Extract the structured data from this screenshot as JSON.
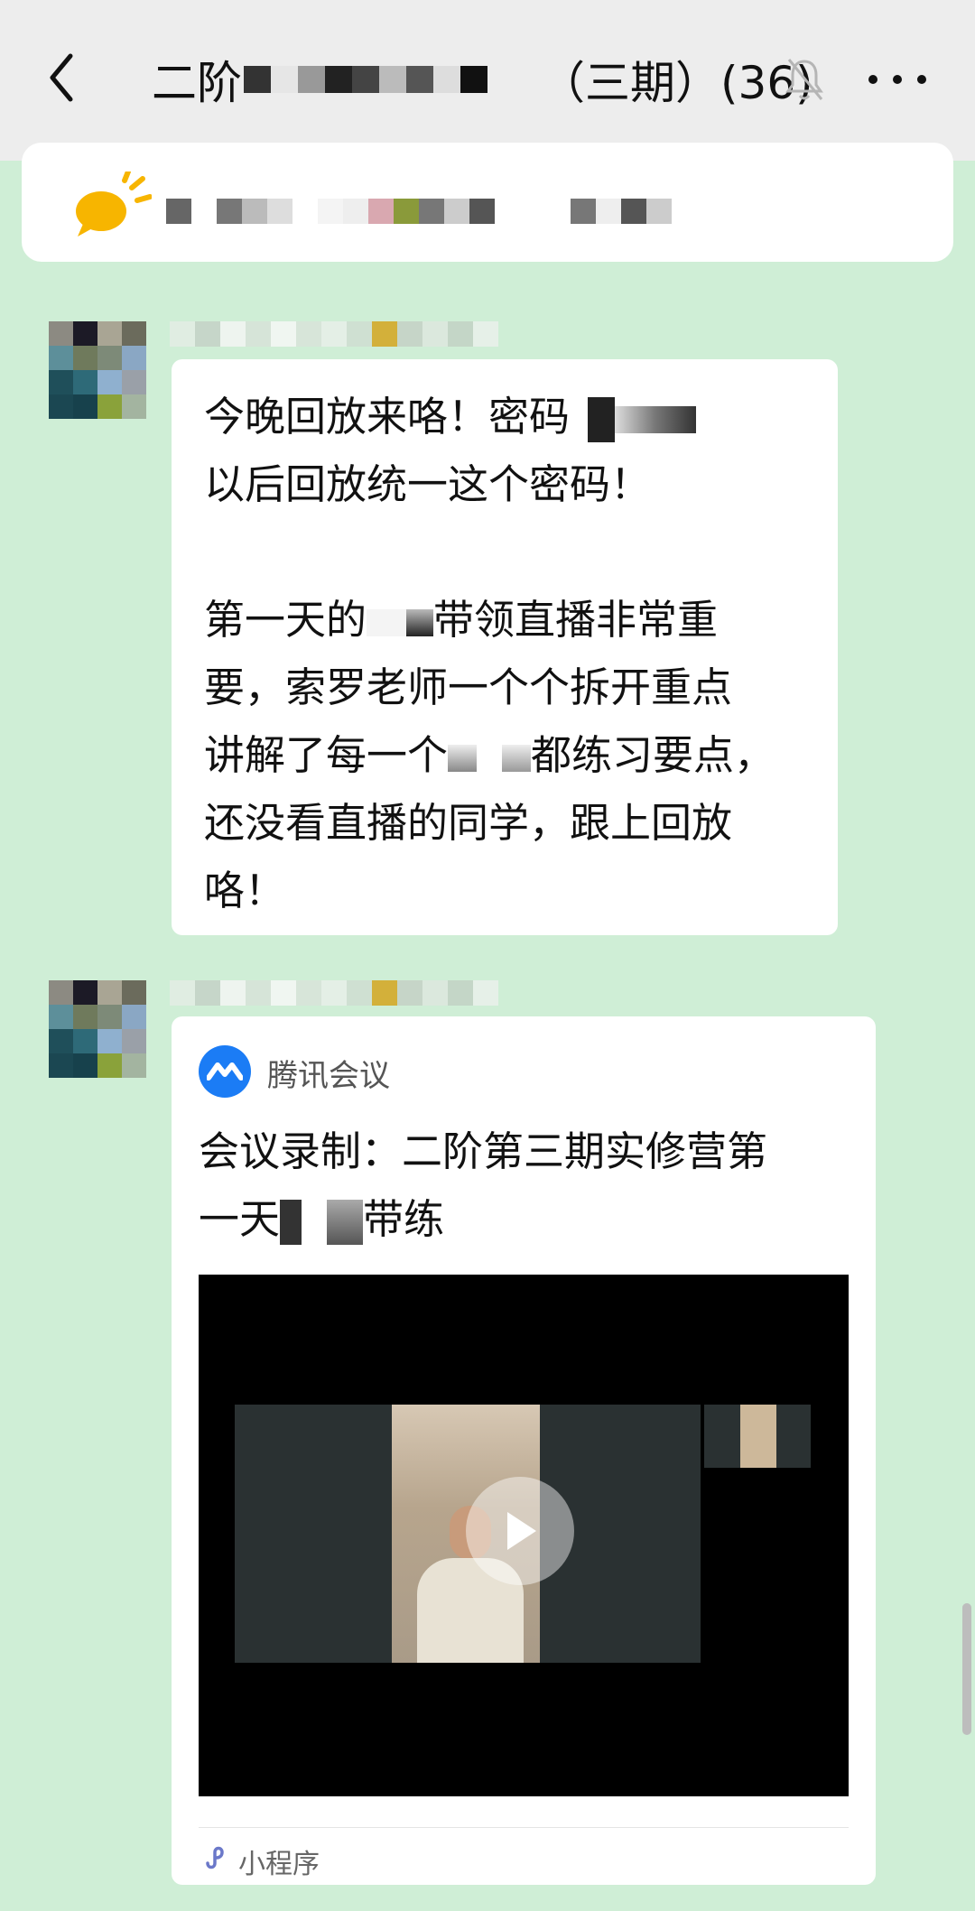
{
  "header": {
    "title_prefix": "二阶",
    "title_suffix": "（三期）(36)",
    "back_icon": "chevron-left-icon",
    "mute_icon": "bell-off-icon",
    "more_icon": "more-dots-icon"
  },
  "notice": {
    "icon": "megaphone-icon",
    "accent": "#f7b500"
  },
  "message1": {
    "line1": "今晚回放来咯！密码",
    "line2": "以后回放统一这个密码！",
    "line3a": "第一天的",
    "line3b": "带领直播非常重",
    "line4": "要，索罗老师一个个拆开重点",
    "line5a": "讲解了每一个",
    "line5b": "都练习要点，",
    "line6": "还没看直播的同学，跟上回放",
    "line7": "咯！"
  },
  "message2": {
    "source": "腾讯会议",
    "title_line1": "会议录制：二阶第三期实修营第",
    "title_line2a": "一天",
    "title_line2b": "带练",
    "footer": "小程序",
    "video_icon": "play-icon",
    "footer_icon": "mini-program-icon"
  },
  "colors": {
    "chat_bg": "#cfeed6",
    "header_bg": "#ededed",
    "brand_blue": "#1b7cf5"
  }
}
